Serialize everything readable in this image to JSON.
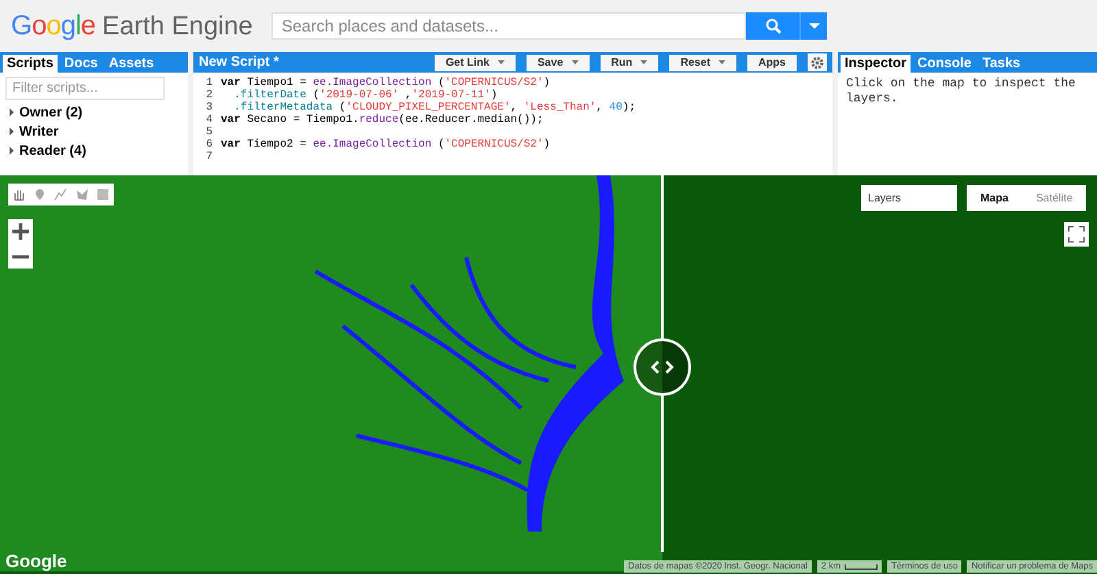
{
  "header": {
    "logo_google": "Google",
    "logo_product": "Earth Engine",
    "search": {
      "placeholder": "Search places and datasets..."
    }
  },
  "scripts_panel": {
    "tabs": [
      {
        "label": "Scripts",
        "selected": true
      },
      {
        "label": "Docs",
        "selected": false
      },
      {
        "label": "Assets",
        "selected": false
      }
    ],
    "filter": {
      "placeholder": "Filter scripts..."
    },
    "items": [
      {
        "label": "Owner",
        "count": "(2)"
      },
      {
        "label": "Writer"
      },
      {
        "label": "Reader",
        "count": "(4)"
      }
    ]
  },
  "editor": {
    "title": "New Script *",
    "buttons": [
      {
        "label": "Get Link",
        "dropdown": true
      },
      {
        "label": "Save",
        "dropdown": true
      },
      {
        "label": "Run",
        "dropdown": true
      },
      {
        "label": "Reset",
        "dropdown": true
      },
      {
        "label": "Apps",
        "dropdown": false
      }
    ],
    "lines": [
      {
        "number": "1",
        "tokens": [
          {
            "kind": "keyword",
            "text": "var"
          },
          {
            "kind": "plain",
            "text": " Tiempo1 = "
          },
          {
            "kind": "func",
            "text": "ee.ImageCollection"
          },
          {
            "kind": "plain",
            "text": " ("
          },
          {
            "kind": "string",
            "text": "'COPERNICUS/S2'"
          },
          {
            "kind": "plain",
            "text": ")"
          }
        ]
      },
      {
        "number": "2",
        "indented": true,
        "tokens": [
          {
            "kind": "prop",
            "text": ".filterDate"
          },
          {
            "kind": "plain",
            "text": " ("
          },
          {
            "kind": "string",
            "text": "'2019-07-06'"
          },
          {
            "kind": "plain",
            "text": " ,"
          },
          {
            "kind": "string",
            "text": "'2019-07-11'"
          },
          {
            "kind": "plain",
            "text": ")"
          }
        ]
      },
      {
        "number": "3",
        "indented": true,
        "tokens": [
          {
            "kind": "prop",
            "text": ".filterMetadata"
          },
          {
            "kind": "plain",
            "text": " ("
          },
          {
            "kind": "string",
            "text": "'CLOUDY_PIXEL_PERCENTAGE'"
          },
          {
            "kind": "plain",
            "text": ", "
          },
          {
            "kind": "string",
            "text": "'Less_Than'"
          },
          {
            "kind": "plain",
            "text": ", "
          },
          {
            "kind": "number",
            "text": "40"
          },
          {
            "kind": "plain",
            "text": ");"
          }
        ]
      },
      {
        "number": "4",
        "tokens": [
          {
            "kind": "keyword",
            "text": "var"
          },
          {
            "kind": "plain",
            "text": " Secano = Tiempo1."
          },
          {
            "kind": "func",
            "text": "reduce"
          },
          {
            "kind": "plain",
            "text": "(ee.Reducer.median());"
          }
        ]
      },
      {
        "number": "5"
      },
      {
        "number": "6",
        "tokens": [
          {
            "kind": "keyword",
            "text": "var"
          },
          {
            "kind": "plain",
            "text": " Tiempo2 = "
          },
          {
            "kind": "func",
            "text": "ee.ImageCollection"
          },
          {
            "kind": "plain",
            "text": " ("
          },
          {
            "kind": "string",
            "text": "'COPERNICUS/S2'"
          },
          {
            "kind": "plain",
            "text": ")"
          }
        ]
      },
      {
        "number": "7"
      }
    ]
  },
  "inspector": {
    "tabs": [
      {
        "label": "Inspector",
        "selected": true
      },
      {
        "label": "Console",
        "selected": false
      },
      {
        "label": "Tasks",
        "selected": false
      }
    ],
    "message": "Click on the map to inspect the layers."
  },
  "map": {
    "layers": "Layers",
    "map_types": [
      {
        "label": "Mapa",
        "selected": true
      },
      {
        "label": "Satélite",
        "selected": false
      }
    ],
    "google_logo": "Google",
    "attribution": [
      {
        "kind": "text",
        "text": "Datos de mapas ©2020 Inst. Geogr. Nacional"
      },
      {
        "kind": "scale",
        "text": "2 km"
      },
      {
        "kind": "link",
        "text": "Términos de uso"
      },
      {
        "kind": "link",
        "text": "Notificar un problema de Maps"
      }
    ]
  }
}
